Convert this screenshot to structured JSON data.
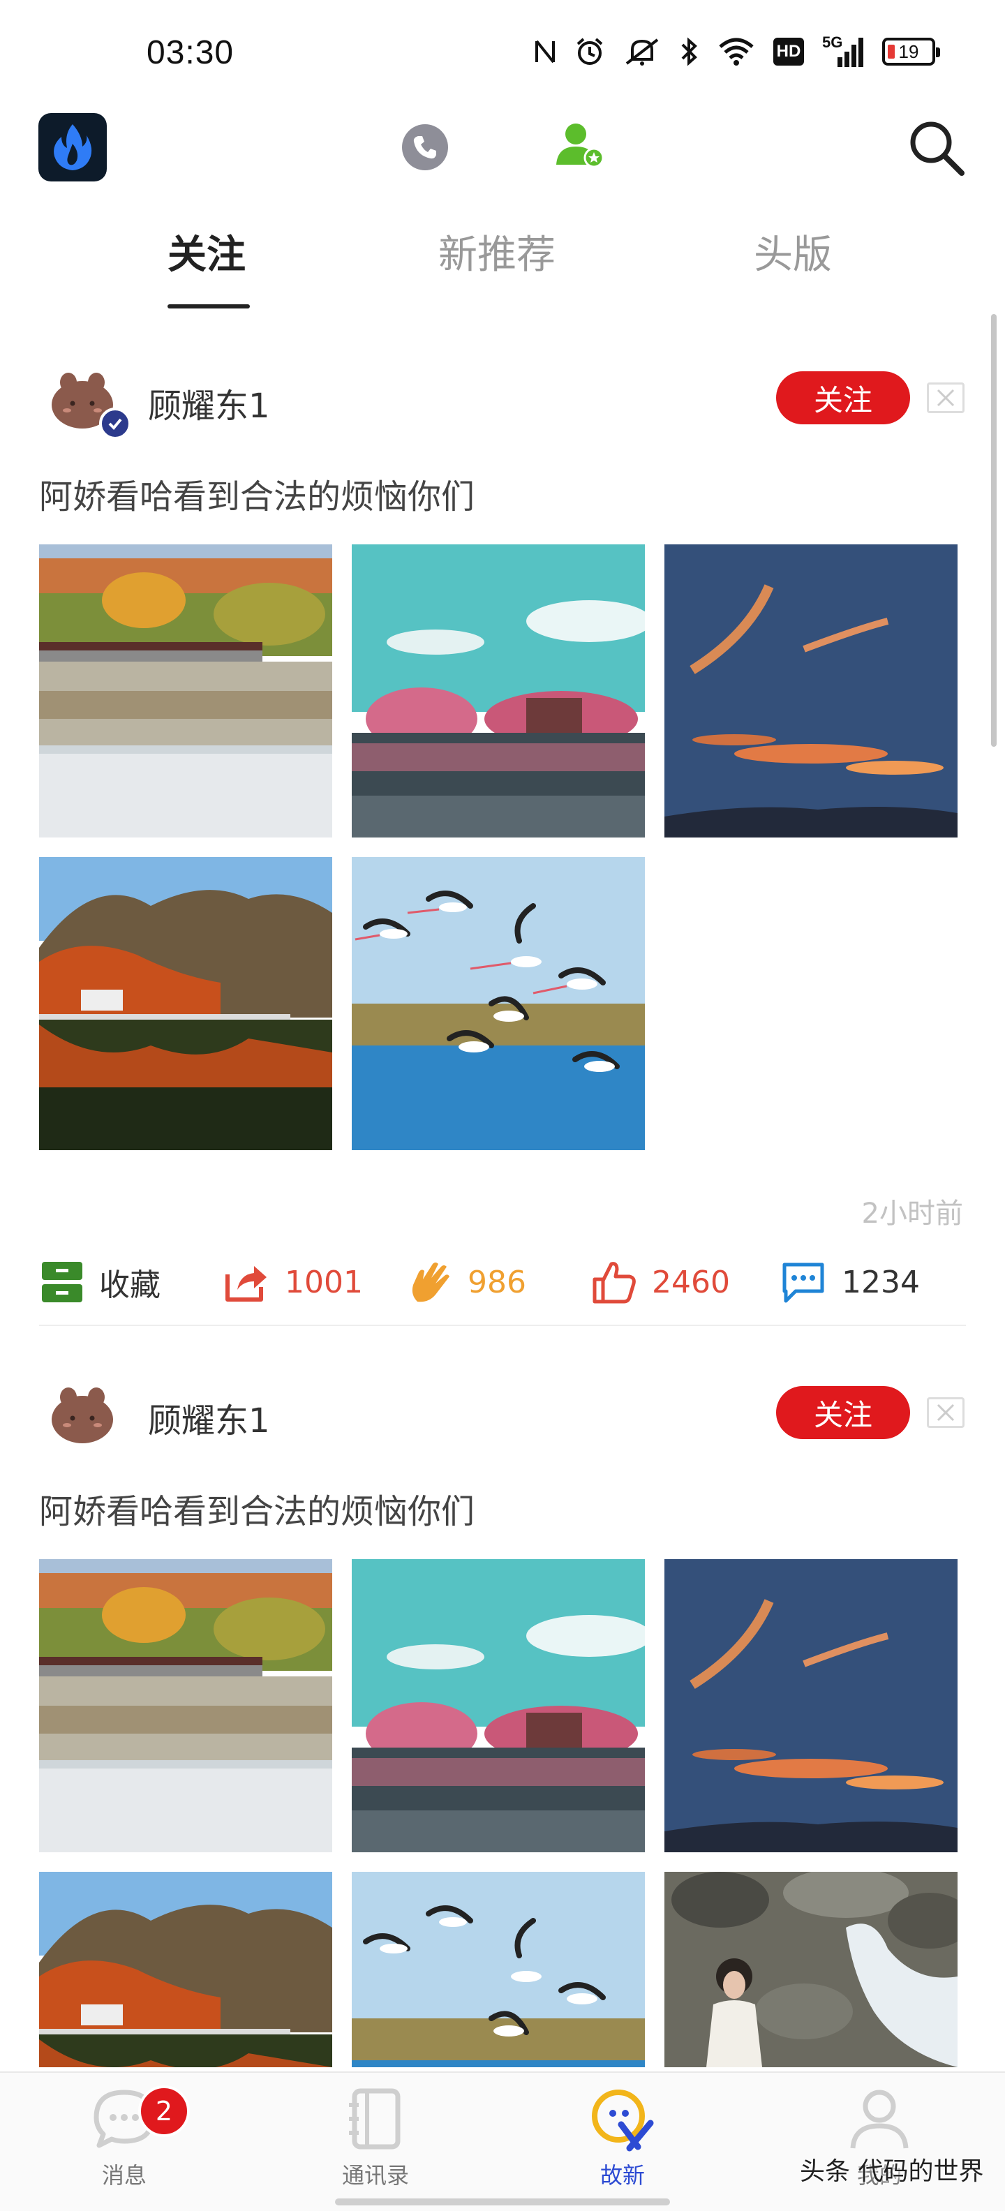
{
  "status_bar": {
    "time": "03:30",
    "signal_label": "5G",
    "hd_label": "HD",
    "battery_level": "19"
  },
  "header": {
    "logo_icon": "flame-logo-icon",
    "phone_icon": "phone-icon",
    "contact_icon": "contact-badge-icon",
    "search_icon": "search-icon"
  },
  "tabs": [
    {
      "label": "关注",
      "active": true
    },
    {
      "label": "新推荐",
      "active": false
    },
    {
      "label": "头版",
      "active": false
    }
  ],
  "posts": [
    {
      "author": "顾耀东1",
      "verified": true,
      "follow_label": "关注",
      "text": "阿娇看哈看到合法的烦恼你们",
      "images": [
        "lakeside-pavilion",
        "pink-trees-lake",
        "sunset-sky",
        "autumn-mountain-lake",
        "flying-birds"
      ],
      "time_ago": "2小时前",
      "actions": {
        "collect_label": "收藏",
        "share_count": "1001",
        "clap_count": "986",
        "like_count": "2460",
        "comment_count": "1234"
      }
    },
    {
      "author": "顾耀东1",
      "verified": false,
      "follow_label": "关注",
      "text": "阿娇看哈看到合法的烦恼你们",
      "images": [
        "lakeside-pavilion",
        "pink-trees-lake",
        "sunset-sky",
        "autumn-mountain-lake",
        "flying-birds",
        "girl-by-stream"
      ]
    }
  ],
  "bottom_nav": [
    {
      "label": "消息",
      "icon": "chat-bubble-icon",
      "badge": "2",
      "active": false
    },
    {
      "label": "通讯录",
      "icon": "contacts-book-icon",
      "active": false
    },
    {
      "label": "故新",
      "icon": "discover-icon",
      "active": true
    },
    {
      "label": "我的",
      "icon": "user-icon",
      "active": false
    }
  ],
  "watermark": "头条 代码的世界",
  "colors": {
    "accent_red": "#e0191d",
    "active_blue": "#2d4bd3",
    "contact_green": "#5cbd2c",
    "collect_green": "#3a8a2a",
    "share_red": "#e04a3a",
    "clap_orange": "#f0a030",
    "comment_blue": "#1f84d6"
  }
}
